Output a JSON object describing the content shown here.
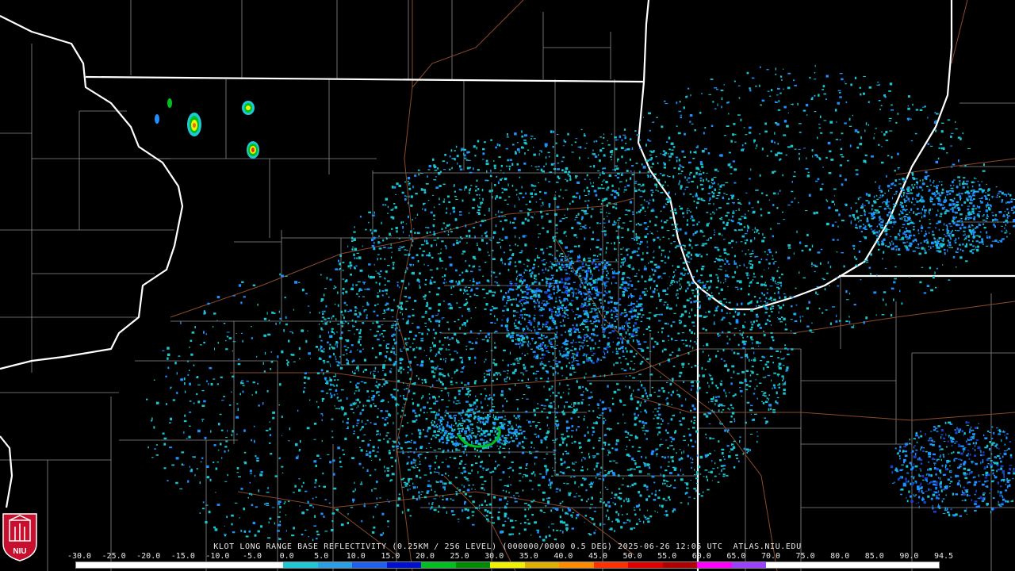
{
  "map": {
    "caption": "KLOT LONG RANGE BASE REFLECTIVITY (0.25KM / 256 LEVEL) (000000/0000 0.5 DEG) 2025-06-26 12:05 UTC  ATLAS.NIU.EDU"
  },
  "logo": {
    "text": "NIU",
    "color": "#c8102e"
  },
  "colorbar": {
    "labels": [
      "-30.0",
      "-25.0",
      "-20.0",
      "-15.0",
      "-10.0",
      "-5.0",
      "0.0",
      "5.0",
      "10.0",
      "15.0",
      "20.0",
      "25.0",
      "30.0",
      "35.0",
      "40.0",
      "45.0",
      "50.0",
      "55.0",
      "60.0",
      "65.0",
      "70.0",
      "75.0",
      "80.0",
      "85.0",
      "90.0",
      "94.5"
    ],
    "colors": [
      "#ffffff",
      "#ffffff",
      "#ffffff",
      "#ffffff",
      "#ffffff",
      "#ffffff",
      "#1ec8d6",
      "#2a9fe6",
      "#2060f0",
      "#0010d0",
      "#00c020",
      "#008c00",
      "#f0f000",
      "#e0b000",
      "#ff8c00",
      "#ff3000",
      "#e00000",
      "#b00000",
      "#ff00ff",
      "#9a40ff",
      "#ffffff",
      "#ffffff",
      "#ffffff",
      "#ffffff",
      "#ffffff"
    ]
  },
  "colors": {
    "state_border": "#ffffff",
    "county_border": "#8a8a8a",
    "highway": "#8b4a2b",
    "echo_light": "#19c5cf",
    "echo_medium": "#1e90ff",
    "echo_dark": "#1a40d0"
  }
}
